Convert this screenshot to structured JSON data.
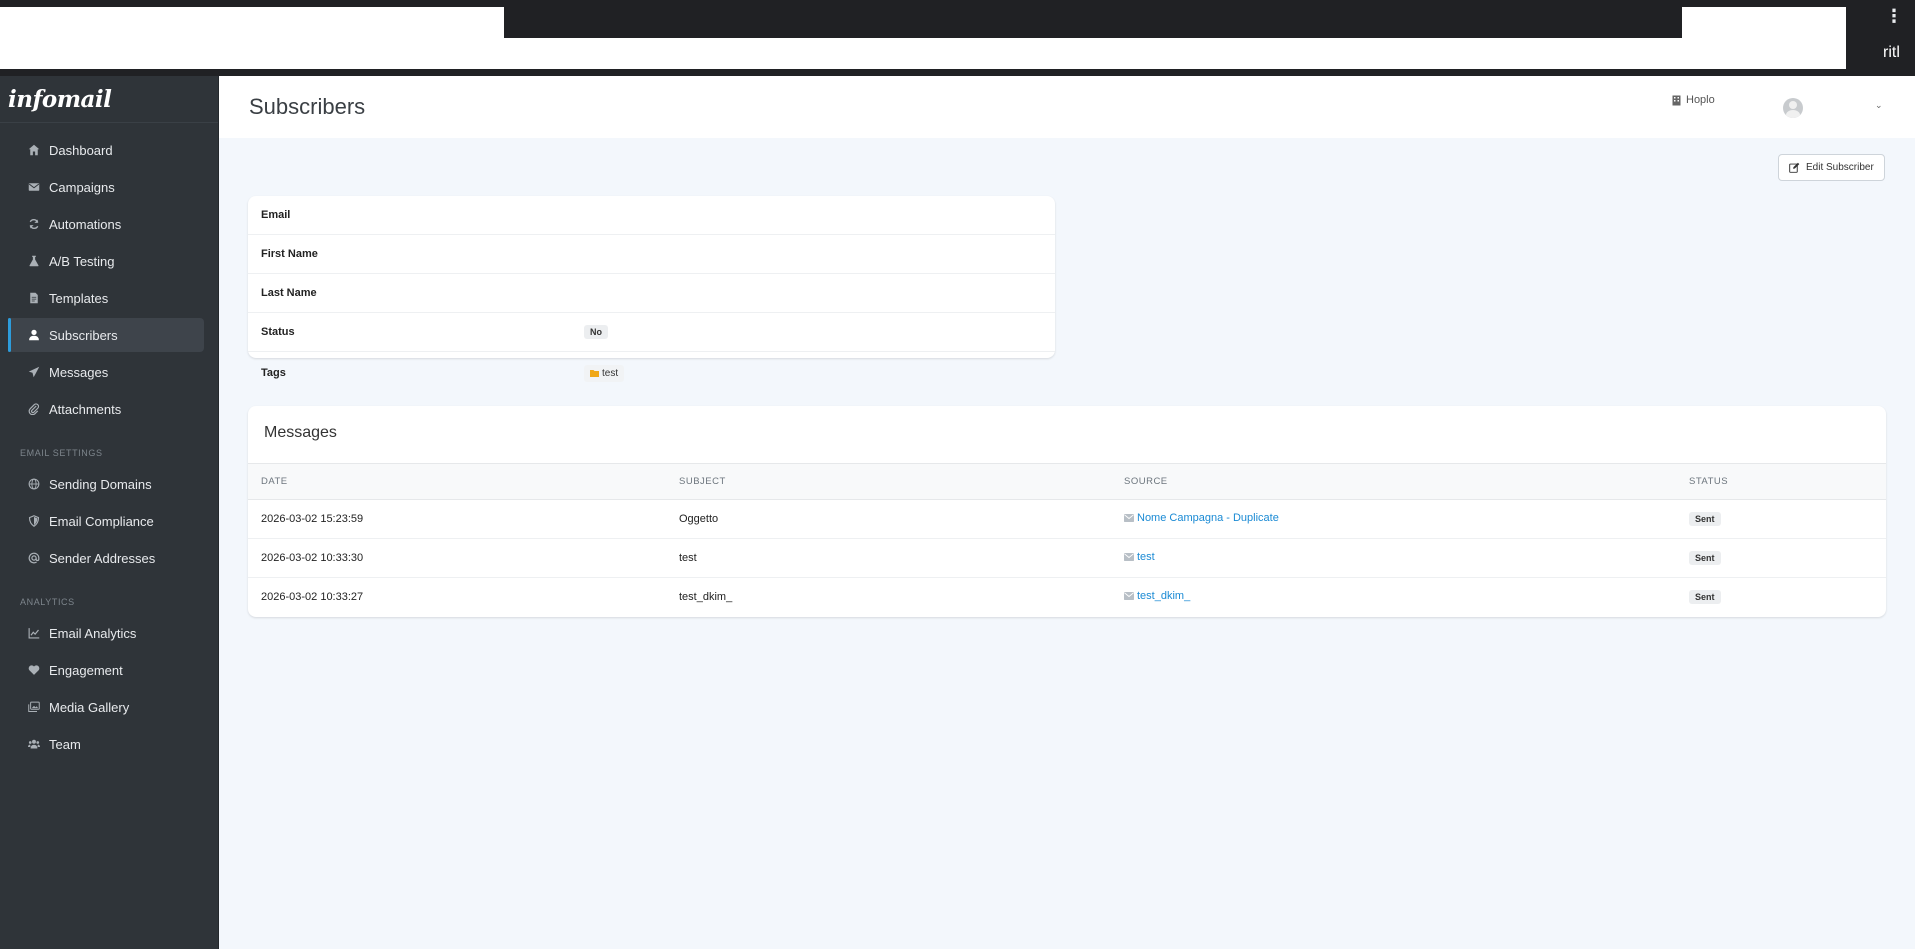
{
  "browser": {
    "menu_glyph": "⋮",
    "edge_text": "ritl"
  },
  "app": {
    "logo": "infomail"
  },
  "sidebar": {
    "items": [
      {
        "label": "Dashboard",
        "icon": "home-icon"
      },
      {
        "label": "Campaigns",
        "icon": "envelope-icon"
      },
      {
        "label": "Automations",
        "icon": "sync-icon"
      },
      {
        "label": "A/B Testing",
        "icon": "flask-icon"
      },
      {
        "label": "Templates",
        "icon": "file-icon"
      },
      {
        "label": "Subscribers",
        "icon": "user-icon",
        "active": true
      },
      {
        "label": "Messages",
        "icon": "paper-plane-icon"
      },
      {
        "label": "Attachments",
        "icon": "paperclip-icon"
      }
    ],
    "email_settings_title": "EMAIL SETTINGS",
    "email_settings": [
      {
        "label": "Sending Domains",
        "icon": "globe-icon"
      },
      {
        "label": "Email Compliance",
        "icon": "shield-icon"
      },
      {
        "label": "Sender Addresses",
        "icon": "at-icon"
      }
    ],
    "analytics_title": "ANALYTICS",
    "analytics": [
      {
        "label": "Email Analytics",
        "icon": "chart-line-icon"
      },
      {
        "label": "Engagement",
        "icon": "heart-icon"
      },
      {
        "label": "Media Gallery",
        "icon": "images-icon"
      },
      {
        "label": "Team",
        "icon": "users-icon"
      }
    ]
  },
  "header": {
    "title": "Subscribers",
    "tenant": "Hoplo",
    "caret": "⌄"
  },
  "actions": {
    "edit_label": "Edit Subscriber"
  },
  "subscriber": {
    "email_label": "Email",
    "first_name_label": "First Name",
    "last_name_label": "Last Name",
    "status_label": "Status",
    "status_value": "No",
    "tags_label": "Tags",
    "tags": [
      "test"
    ]
  },
  "messages": {
    "title": "Messages",
    "columns": [
      "DATE",
      "SUBJECT",
      "SOURCE",
      "STATUS"
    ],
    "rows": [
      {
        "date": "2026-03-02 15:23:59",
        "subject": "Oggetto",
        "source": "Nome Campagna - Duplicate",
        "status": "Sent"
      },
      {
        "date": "2026-03-02 10:33:30",
        "subject": "test",
        "source": "test",
        "status": "Sent"
      },
      {
        "date": "2026-03-02 10:33:27",
        "subject": "test_dkim_",
        "source": "test_dkim_",
        "status": "Sent"
      }
    ]
  },
  "colors": {
    "sidebar_bg": "#2f3439",
    "accent": "#2d9cdb",
    "link": "#1a8ad4",
    "page_bg": "#f3f7fc"
  }
}
